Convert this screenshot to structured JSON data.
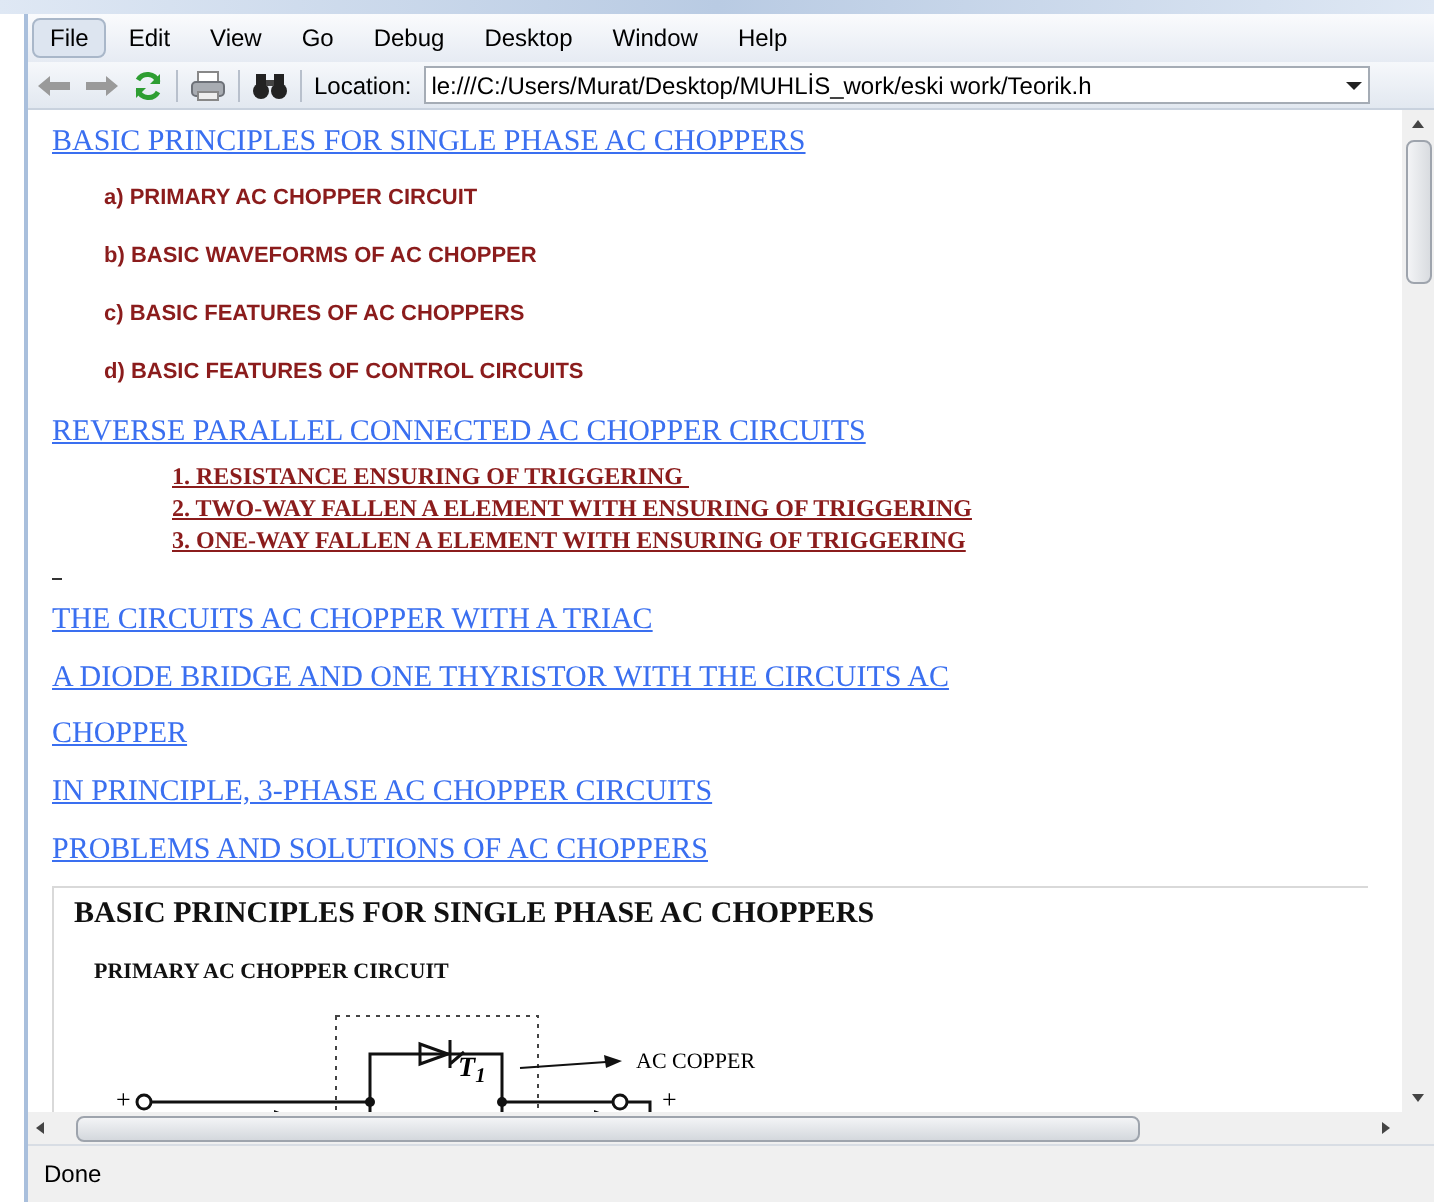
{
  "menu": [
    {
      "label": "File",
      "selected": true
    },
    {
      "label": "Edit",
      "selected": false
    },
    {
      "label": "View",
      "selected": false
    },
    {
      "label": "Go",
      "selected": false
    },
    {
      "label": "Debug",
      "selected": false
    },
    {
      "label": "Desktop",
      "selected": false
    },
    {
      "label": "Window",
      "selected": false
    },
    {
      "label": "Help",
      "selected": false
    }
  ],
  "location": {
    "label": "Location:",
    "value": "le:///C:/Users/Murat/Desktop/MUHLİS_work/eski work/Teorik.h"
  },
  "entries": [
    {
      "kind": "link",
      "text": "BASIC PRINCIPLES FOR SINGLE PHASE AC CHOPPERS"
    },
    {
      "kind": "sub",
      "text": "a)  PRIMARY AC CHOPPER CIRCUIT"
    },
    {
      "kind": "sub",
      "text": "b)  BASIC WAVEFORMS OF AC CHOPPER"
    },
    {
      "kind": "sub",
      "text": "c)  BASIC FEATURES OF AC CHOPPERS"
    },
    {
      "kind": "sub",
      "text": "d)  BASIC FEATURES OF CONTROL CIRCUITS"
    },
    {
      "kind": "link",
      "text": "REVERSE PARALLEL CONNECTED AC CHOPPER CIRCUITS"
    },
    {
      "kind": "numbered",
      "text": "1. RESISTANCE ENSURING OF TRIGGERING "
    },
    {
      "kind": "numbered",
      "text": "2. TWO-WAY FALLEN A ELEMENT WITH ENSURING OF TRIGGERING"
    },
    {
      "kind": "numbered",
      "text": "3. ONE-WAY FALLEN A ELEMENT WITH ENSURING OF TRIGGERING"
    },
    {
      "kind": "blank"
    },
    {
      "kind": "link",
      "text": "THE CIRCUITS AC CHOPPER WITH A TRIAC"
    },
    {
      "kind": "link",
      "text": "A DIODE BRIDGE AND ONE THYRISTOR WITH THE CIRCUITS AC CHOPPER "
    },
    {
      "kind": "link",
      "text": "IN PRINCIPLE, 3-PHASE AC CHOPPER CIRCUITS"
    },
    {
      "kind": "link",
      "text": "PROBLEMS AND SOLUTIONS OF AC CHOPPERS"
    }
  ],
  "preview": {
    "heading": "BASIC PRINCIPLES FOR SINGLE PHASE AC CHOPPERS",
    "subheading": "PRIMARY AC CHOPPER CIRCUIT",
    "input_sign": "+",
    "output_sign": "+",
    "thyristor_label": "T$_{1}$",
    "output_label": "AC COPPER"
  },
  "status": "Done"
}
